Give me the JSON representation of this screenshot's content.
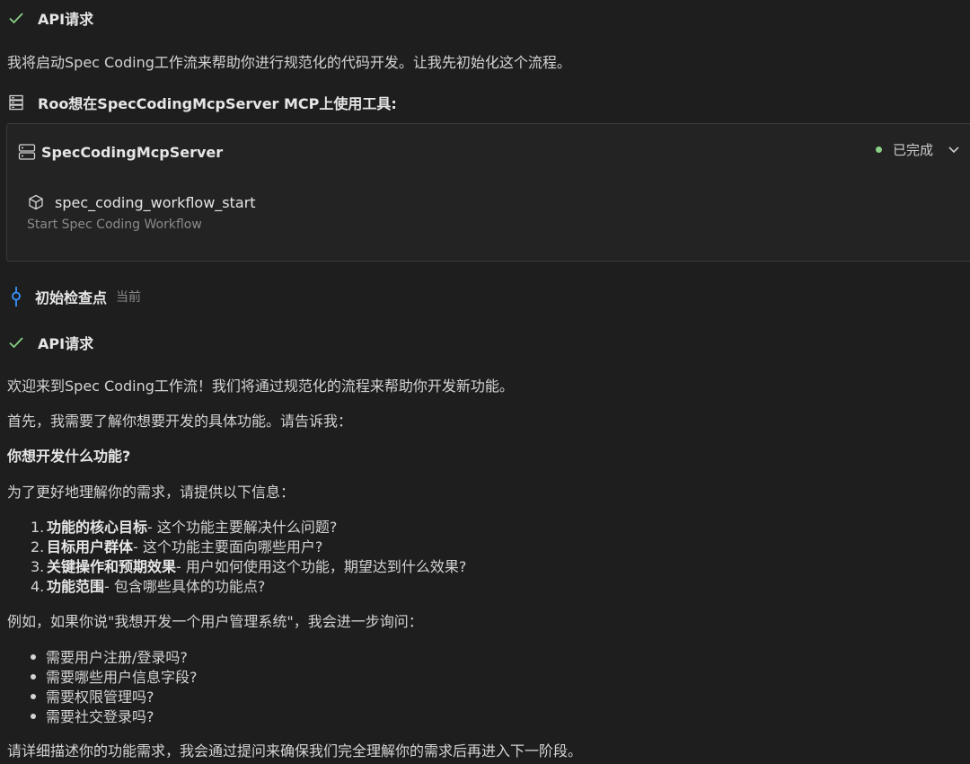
{
  "api_request_1": {
    "label": "API请求"
  },
  "intro_message": "我将启动Spec Coding工作流来帮助你进行规范化的代码开发。让我先初始化这个流程。",
  "mcp_notice": {
    "text": "Roo想在SpecCodingMcpServer MCP上使用工具:"
  },
  "mcp_card": {
    "server_name": "SpecCodingMcpServer",
    "status_label": "已完成",
    "status_color": "#89d185",
    "tool_name": "spec_coding_workflow_start",
    "tool_description": "Start Spec Coding Workflow"
  },
  "checkpoint": {
    "label": "初始检查点",
    "current_label": "当前"
  },
  "api_request_2": {
    "label": "API请求"
  },
  "response": {
    "welcome": "欢迎来到Spec Coding工作流！我们将通过规范化的流程来帮助你开发新功能。",
    "first": "首先，我需要了解你想要开发的具体功能。请告诉我：",
    "question": "你想开发什么功能?",
    "info_prompt": "为了更好地理解你的需求，请提供以下信息：",
    "numbered": [
      {
        "num": "1.",
        "title": "功能的核心目标",
        "desc": " - 这个功能主要解决什么问题?"
      },
      {
        "num": "2.",
        "title": "目标用户群体",
        "desc": " - 这个功能主要面向哪些用户?"
      },
      {
        "num": "3.",
        "title": "关键操作和预期效果",
        "desc": " - 用户如何使用这个功能，期望达到什么效果?"
      },
      {
        "num": "4.",
        "title": "功能范围",
        "desc": " - 包含哪些具体的功能点?"
      }
    ],
    "example": "例如，如果你说\"我想开发一个用户管理系统\"，我会进一步询问：",
    "bullets": [
      "需要用户注册/登录吗?",
      "需要哪些用户信息字段?",
      "需要权限管理吗?",
      "需要社交登录吗?"
    ],
    "closing": "请详细描述你的功能需求，我会通过提问来确保我们完全理解你的需求后再进入下一阶段。"
  },
  "colors": {
    "check": "#89d185",
    "accent": "#3794ff"
  },
  "icons": {
    "check": "check-icon",
    "server": "server-icon",
    "cube": "cube-icon",
    "chevron": "chevron-down-icon",
    "checkpoint": "git-commit-icon"
  }
}
